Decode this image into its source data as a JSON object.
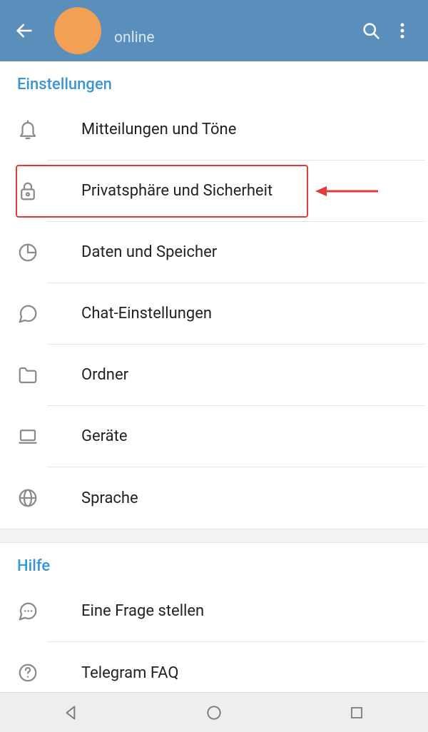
{
  "header": {
    "status": "online"
  },
  "sections": {
    "settings": {
      "title": "Einstellungen",
      "items": [
        {
          "label": "Mitteilungen und Töne"
        },
        {
          "label": "Privatsphäre und Sicherheit"
        },
        {
          "label": "Daten und Speicher"
        },
        {
          "label": "Chat-Einstellungen"
        },
        {
          "label": "Ordner"
        },
        {
          "label": "Geräte"
        },
        {
          "label": "Sprache"
        }
      ]
    },
    "help": {
      "title": "Hilfe",
      "items": [
        {
          "label": "Eine Frage stellen"
        },
        {
          "label": "Telegram FAQ"
        }
      ]
    }
  }
}
